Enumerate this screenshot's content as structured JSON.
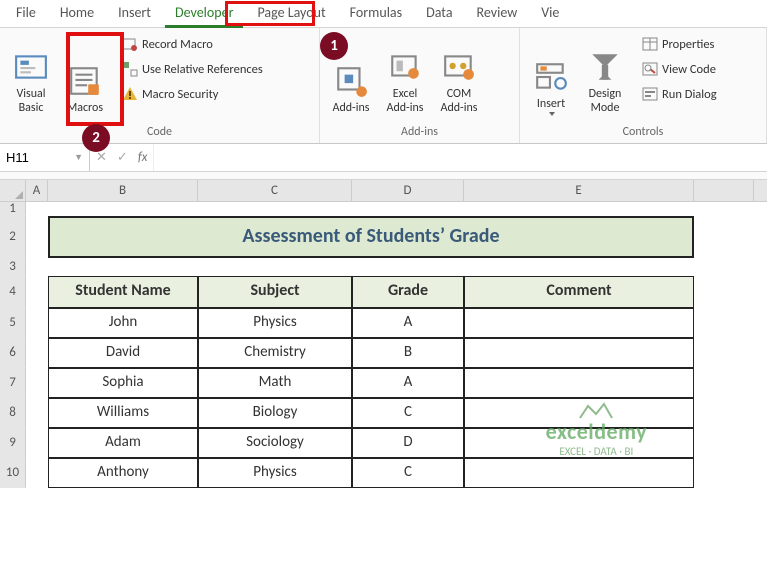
{
  "tabs": [
    "File",
    "Home",
    "Insert",
    "Developer",
    "Page Layout",
    "Formulas",
    "Data",
    "Review",
    "Vie"
  ],
  "active_tab": "Developer",
  "ribbon": {
    "code": {
      "visual_basic": "Visual Basic",
      "macros": "Macros",
      "record_macro": "Record Macro",
      "use_relative": "Use Relative References",
      "macro_security": "Macro Security",
      "group_label": "Code"
    },
    "addins": {
      "add_ins": "Add-ins",
      "excel_addins": "Excel Add-ins",
      "com_addins": "COM Add-ins",
      "group_label": "Add-ins"
    },
    "controls": {
      "insert": "Insert",
      "design_mode": "Design Mode",
      "properties": "Properties",
      "view_code": "View Code",
      "run_dialog": "Run Dialog",
      "group_label": "Controls"
    }
  },
  "callouts": {
    "one": "1",
    "two": "2"
  },
  "namebox_value": "H11",
  "title": "Assessment of Students’ Grade",
  "columns": {
    "A": "A",
    "B": "B",
    "C": "C",
    "D": "D",
    "E": "E"
  },
  "rows": [
    "1",
    "2",
    "3",
    "4",
    "5",
    "6",
    "7",
    "8",
    "9",
    "10"
  ],
  "headers": {
    "name": "Student Name",
    "subject": "Subject",
    "grade": "Grade",
    "comment": "Comment"
  },
  "students": [
    {
      "name": "John",
      "subject": "Physics",
      "grade": "A",
      "comment": ""
    },
    {
      "name": "David",
      "subject": "Chemistry",
      "grade": "B",
      "comment": ""
    },
    {
      "name": "Sophia",
      "subject": "Math",
      "grade": "A",
      "comment": ""
    },
    {
      "name": "Williams",
      "subject": "Biology",
      "grade": "C",
      "comment": ""
    },
    {
      "name": "Adam",
      "subject": "Sociology",
      "grade": "D",
      "comment": ""
    },
    {
      "name": "Anthony",
      "subject": "Physics",
      "grade": "C",
      "comment": ""
    }
  ],
  "watermark": {
    "brand": "exceldemy",
    "tag": "EXCEL · DATA · BI"
  }
}
